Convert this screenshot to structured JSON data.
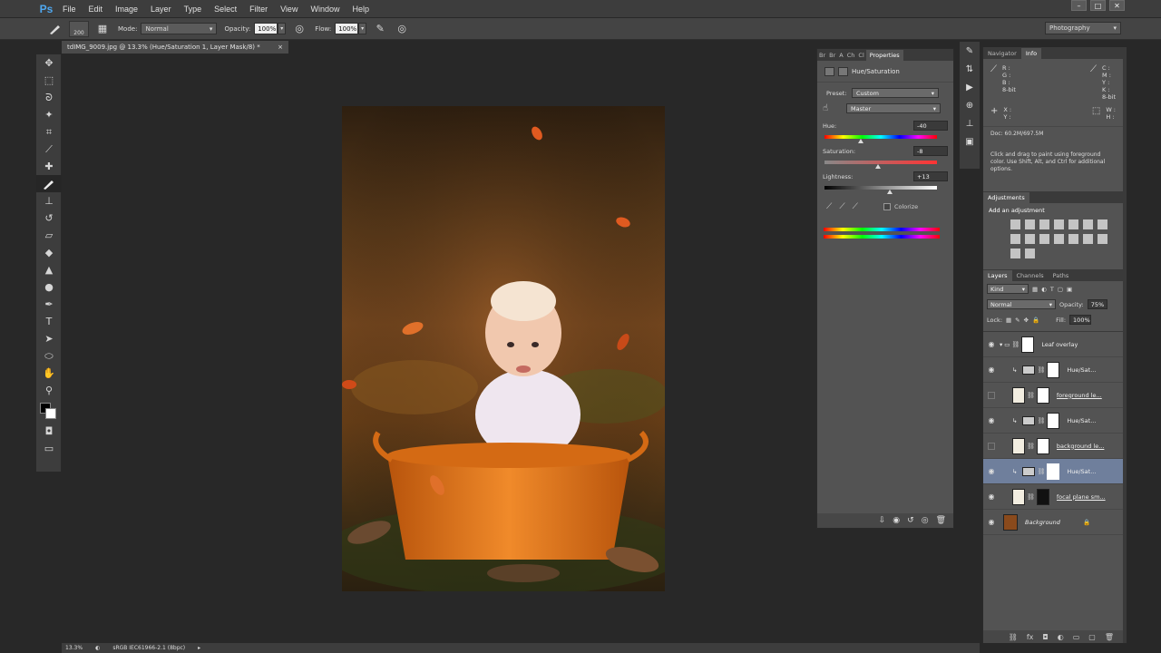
{
  "app": {
    "logo": "Ps"
  },
  "menu": [
    "File",
    "Edit",
    "Image",
    "Layer",
    "Type",
    "Select",
    "Filter",
    "View",
    "Window",
    "Help"
  ],
  "window_controls": [
    "–",
    "□",
    "✕"
  ],
  "options_bar": {
    "brush_size": "200",
    "mode_label": "Mode:",
    "mode_value": "Normal",
    "opacity_label": "Opacity:",
    "opacity_value": "100%",
    "flow_label": "Flow:",
    "flow_value": "100%"
  },
  "workspace": "Photography",
  "document_tab": {
    "title": "tdIMG_9009.jpg @ 13.3% (Hue/Saturation 1, Layer Mask/8) *",
    "close": "×"
  },
  "status_bar": {
    "zoom": "13.3%",
    "profile": "sRGB IEC61966-2.1 (8bpc)"
  },
  "properties_panel": {
    "tabs": [
      "Br",
      "Br",
      "A",
      "Ch",
      "Cl",
      "Properties"
    ],
    "title": "Hue/Saturation",
    "preset_label": "Preset:",
    "preset_value": "Custom",
    "channel_value": "Master",
    "hue_label": "Hue:",
    "hue_value": "-40",
    "saturation_label": "Saturation:",
    "saturation_value": "-8",
    "lightness_label": "Lightness:",
    "lightness_value": "+13",
    "colorize_label": "Colorize"
  },
  "navigator_panel": {
    "tabs": [
      "Navigator",
      "Info"
    ],
    "rgb_labels": "R :\nG :\nB :",
    "bit_left": "8-bit",
    "cmyk_labels": "C :\nM :\nY :\nK :",
    "bit_right": "8-bit",
    "xy_labels": "X :\nY :",
    "wh_labels": "W :\nH :",
    "doc_size": "Doc: 60.2M/697.5M",
    "hint": "Click and drag to paint using foreground color.  Use Shift, Alt, and Ctrl for additional options."
  },
  "adjustments_panel": {
    "title": "Adjustments",
    "subtitle": "Add an adjustment"
  },
  "layers_panel": {
    "tabs": [
      "Layers",
      "Channels",
      "Paths"
    ],
    "kind_label": "Kind",
    "blend_mode": "Normal",
    "opacity_label": "Opacity:",
    "opacity_value": "75%",
    "lock_label": "Lock:",
    "fill_label": "Fill:",
    "fill_value": "100%",
    "layers": [
      {
        "name": "Leaf overlay"
      },
      {
        "name": "Hue/Sat..."
      },
      {
        "name": "foreground le..."
      },
      {
        "name": "Hue/Sat..."
      },
      {
        "name": "background le..."
      },
      {
        "name": "Hue/Sat..."
      },
      {
        "name": "focal plane sm..."
      },
      {
        "name": "Background"
      }
    ]
  },
  "colors": {
    "accent": "#4fa8f0",
    "selection": "#6f7f9c",
    "tub": "#e07a1c"
  }
}
